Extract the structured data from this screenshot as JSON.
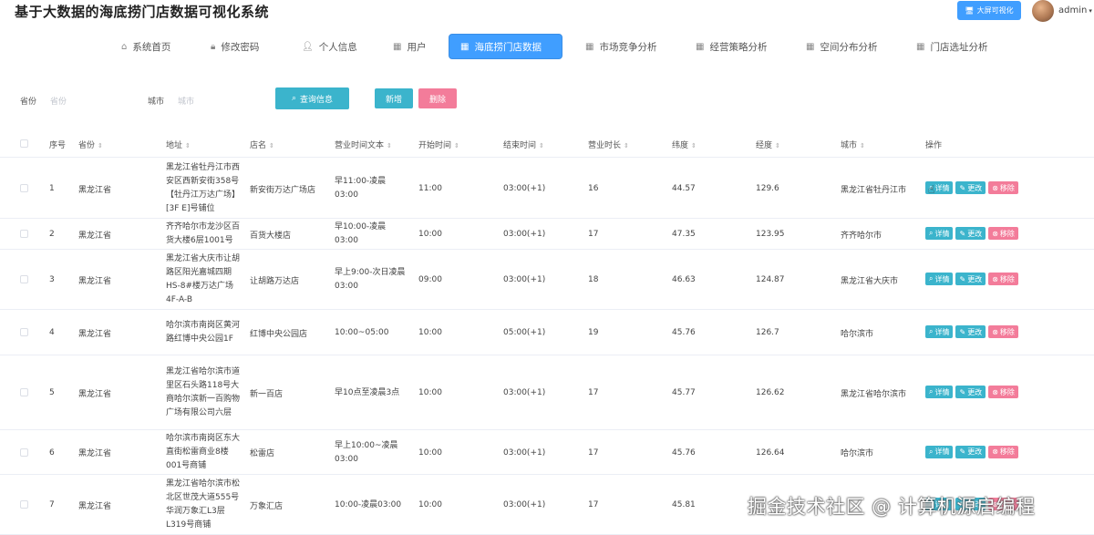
{
  "header": {
    "title": "基于大数据的海底捞门店数据可视化系统",
    "bigscreen_label": "大屏可视化",
    "user": "admin"
  },
  "nav": [
    {
      "label": "系统首页",
      "icon": "home-icon"
    },
    {
      "label": "修改密码",
      "icon": "lock-icon"
    },
    {
      "label": "个人信息",
      "icon": "user-icon"
    },
    {
      "label": "用户",
      "icon": "grid-icon"
    },
    {
      "label": "海底捞门店数据",
      "icon": "grid-icon",
      "active": true
    },
    {
      "label": "市场竞争分析",
      "icon": "grid-icon"
    },
    {
      "label": "经营策略分析",
      "icon": "grid-icon"
    },
    {
      "label": "空间分布分析",
      "icon": "grid-icon"
    },
    {
      "label": "门店选址分析",
      "icon": "grid-icon"
    }
  ],
  "search": {
    "province_label": "省份",
    "province_placeholder": "省份",
    "city_label": "城市",
    "city_placeholder": "城市",
    "query_label": "查询信息",
    "add_label": "新增",
    "delete_label": "删除"
  },
  "table": {
    "headers": [
      "序号",
      "省份",
      "地址",
      "店名",
      "营业时间文本",
      "开始时间",
      "结束时间",
      "营业时长",
      "纬度",
      "经度",
      "城市",
      "操作"
    ],
    "op_labels": {
      "detail": "详情",
      "edit": "更改",
      "remove": "移除"
    },
    "rows": [
      {
        "no": "1",
        "province": "黑龙江省",
        "address": "黑龙江省牡丹江市西安区西新安街358号【牡丹江万达广场】[3F E]号铺位",
        "name": "新安街万达广场店",
        "hours_text": "早11:00-凌晨03:00",
        "start": "11:00",
        "end": "03:00(+1)",
        "duration": "16",
        "lat": "44.57",
        "lng": "129.6",
        "city": "黑龙江省牡丹江市"
      },
      {
        "no": "2",
        "province": "黑龙江省",
        "address": "齐齐哈尔市龙沙区百货大楼6层1001号",
        "name": "百货大楼店",
        "hours_text": "早10:00-凌晨03:00",
        "start": "10:00",
        "end": "03:00(+1)",
        "duration": "17",
        "lat": "47.35",
        "lng": "123.95",
        "city": "齐齐哈尔市"
      },
      {
        "no": "3",
        "province": "黑龙江省",
        "address": "黑龙江省大庆市让胡路区阳光嘉城四期HS-8#楼万达广场4F-A-B",
        "name": "让胡路万达店",
        "hours_text": "早上9:00-次日凌晨03:00",
        "start": "09:00",
        "end": "03:00(+1)",
        "duration": "18",
        "lat": "46.63",
        "lng": "124.87",
        "city": "黑龙江省大庆市"
      },
      {
        "no": "4",
        "province": "黑龙江省",
        "address": "哈尔滨市南岗区黄河路红博中央公园1F",
        "name": "红博中央公园店",
        "hours_text": "10:00~05:00",
        "start": "10:00",
        "end": "05:00(+1)",
        "duration": "19",
        "lat": "45.76",
        "lng": "126.7",
        "city": "哈尔滨市"
      },
      {
        "no": "5",
        "province": "黑龙江省",
        "address": "黑龙江省哈尔滨市道里区石头路118号大商哈尔滨新一百购物广场有限公司六层",
        "name": "新一百店",
        "hours_text": "早10点至凌晨3点",
        "start": "10:00",
        "end": "03:00(+1)",
        "duration": "17",
        "lat": "45.77",
        "lng": "126.62",
        "city": "黑龙江省哈尔滨市"
      },
      {
        "no": "6",
        "province": "黑龙江省",
        "address": "哈尔滨市南岗区东大直街松雷商业8楼001号商铺",
        "name": "松雷店",
        "hours_text": "早上10:00~凌晨03:00",
        "start": "10:00",
        "end": "03:00(+1)",
        "duration": "17",
        "lat": "45.76",
        "lng": "126.64",
        "city": "哈尔滨市"
      },
      {
        "no": "7",
        "province": "黑龙江省",
        "address": "黑龙江省哈尔滨市松北区世茂大道555号华润万象汇L3层L319号商铺",
        "name": "万象汇店",
        "hours_text": "10:00-凌晨03:00",
        "start": "10:00",
        "end": "03:00(+1)",
        "duration": "17",
        "lat": "45.81",
        "lng": "",
        "city": ""
      }
    ]
  },
  "watermark": "掘金技术社区 @ 计算机源启编程"
}
